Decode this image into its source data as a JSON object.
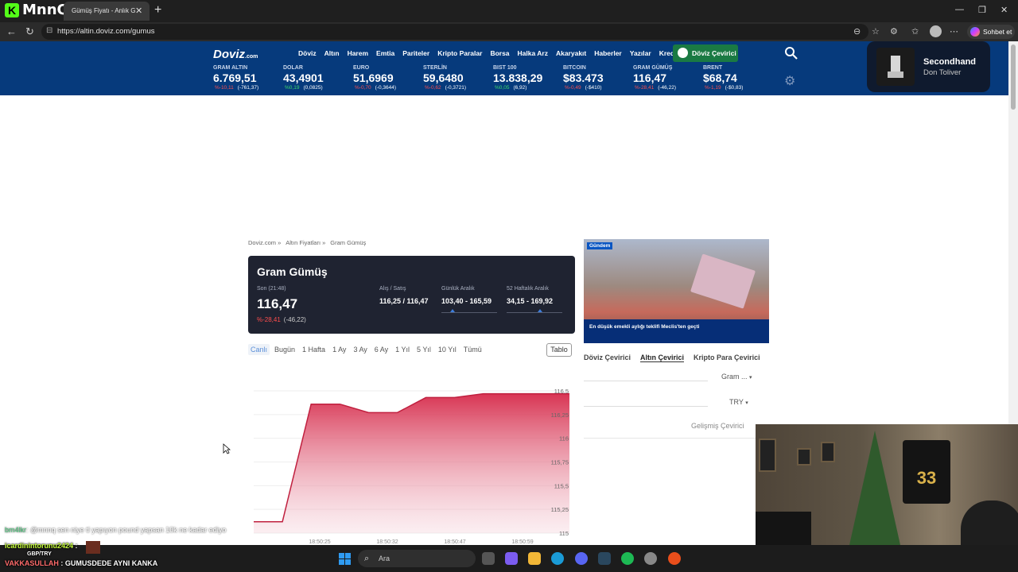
{
  "browser": {
    "app_logo": "MnnQ",
    "tab_title": "Gümüş Fiyatı - Anlık G",
    "url": "https://altin.doviz.com/gumus",
    "chat_button": "Sohbet et"
  },
  "site": {
    "logo": "Doviz",
    "logo_suffix": ".com",
    "nav": [
      "Döviz",
      "Altın",
      "Harem",
      "Emtia",
      "Pariteler",
      "Kripto Paralar",
      "Borsa",
      "Halka Arz",
      "Akaryakıt",
      "Haberler",
      "Yazılar",
      "Kredi"
    ],
    "converter_button": "Döviz Çevirici",
    "tickers": [
      {
        "label": "GRAM ALTIN",
        "value": "6.769,51",
        "pct": "%-10,11",
        "abs": "(-761,37)",
        "dir": "down"
      },
      {
        "label": "DOLAR",
        "value": "43,4901",
        "pct": "%0,19",
        "abs": "(0,0825)",
        "dir": "up"
      },
      {
        "label": "EURO",
        "value": "51,6969",
        "pct": "%-0,70",
        "abs": "(-0,3644)",
        "dir": "down"
      },
      {
        "label": "STERLİN",
        "value": "59,6480",
        "pct": "%-0,62",
        "abs": "(-0,3721)",
        "dir": "down"
      },
      {
        "label": "BIST 100",
        "value": "13.838,29",
        "pct": "%0,05",
        "abs": "(6,92)",
        "dir": "up"
      },
      {
        "label": "BITCOIN",
        "value": "$83.473",
        "pct": "%-0,49",
        "abs": "(-$410)",
        "dir": "down"
      },
      {
        "label": "GRAM GÜMÜŞ",
        "value": "116,47",
        "pct": "%-28,41",
        "abs": "(-46,22)",
        "dir": "down"
      },
      {
        "label": "BRENT",
        "value": "$68,74",
        "pct": "%-1,19",
        "abs": "(-$0,83)",
        "dir": "down"
      }
    ]
  },
  "spotify": {
    "title": "Secondhand",
    "artist": "Don Toliver"
  },
  "breadcrumb": [
    "Doviz.com »",
    "Altın Fiyatları »",
    "Gram Gümüş"
  ],
  "instrument": {
    "title": "Gram Gümüş",
    "last_label": "Son (21:48)",
    "last_value": "116,47",
    "change_pct": "%-28,41",
    "change_abs": "(-46,22)",
    "bidask_label": "Alış / Satış",
    "bidask_value": "116,25 / 116,47",
    "daily_label": "Günlük Aralık",
    "daily_value": "103,40 - 165,59",
    "week52_label": "52 Haftalık Aralık",
    "week52_value": "34,15 - 169,92",
    "daily_marker": 0.2,
    "week52_marker": 0.6
  },
  "periods": [
    "Canlı",
    "Bugün",
    "1 Hafta",
    "1 Ay",
    "3 Ay",
    "6 Ay",
    "1 Yıl",
    "5 Yıl",
    "10 Yıl",
    "Tümü"
  ],
  "active_period": "Canlı",
  "table_button": "Tablo",
  "chart_data": {
    "type": "area",
    "x": [
      "18:49:52",
      "18:50:05",
      "18:50:10",
      "18:50:22",
      "18:50:27",
      "18:50:32",
      "18:50:37",
      "18:50:42",
      "18:50:47",
      "18:50:52",
      "18:50:57",
      "18:51:02"
    ],
    "x_ticks": [
      "18:50:25",
      "18:50:32",
      "18:50:47",
      "18:50:59"
    ],
    "series": [
      {
        "values": [
          115.12,
          115.12,
          116.36,
          116.36,
          116.27,
          116.27,
          116.43,
          116.43,
          116.47,
          116.47,
          116.47,
          116.47
        ]
      }
    ],
    "yticks": [
      "116,5",
      "116,25",
      "116",
      "115,75",
      "115,5",
      "115,25",
      "115"
    ],
    "ylim": [
      115,
      116.5
    ],
    "color": "#d62a4a"
  },
  "news": {
    "tag": "Gündem",
    "caption": "En düşük emekli aylığı teklifi Meclis'ten geçti"
  },
  "converter": {
    "tabs": [
      "Döviz Çevirici",
      "Altın Çevirici",
      "Kripto Para Çevirici"
    ],
    "selected_tab": "Altın Çevirici",
    "from_unit": "Gram ...",
    "to_unit": "TRY",
    "advanced": "Gelişmiş Çevirici"
  },
  "chat": [
    {
      "user": "bm4lkr",
      "text": ": @mnnq sen niye tl yapıyon pound yapsan 10k ne kadar ediyo"
    },
    {
      "user": "icardinintorunu2424",
      "text": " :"
    },
    {
      "user": "",
      "text": "GBP/TRY"
    },
    {
      "user": "VAKKASULLAH",
      "text": " : GUMUSDEDE AYNI KANKA"
    }
  ],
  "taskbar": {
    "search_placeholder": "Ara"
  },
  "jersey_number": "33"
}
